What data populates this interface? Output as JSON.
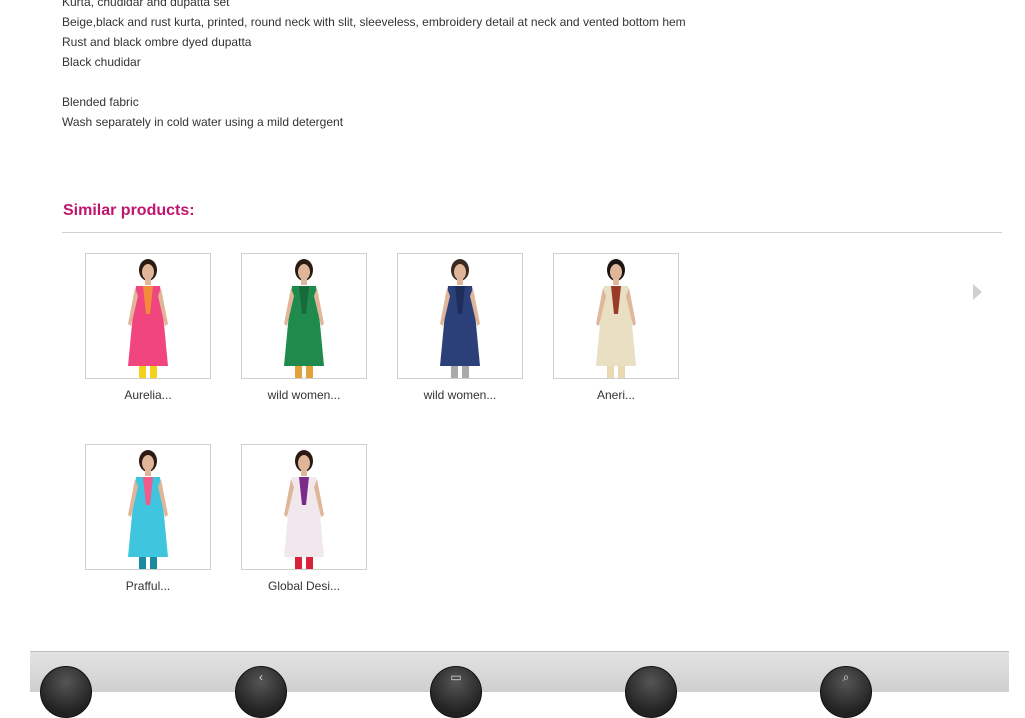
{
  "description": {
    "lines": [
      "Kurta, chudidar and dupatta set",
      "Beige,black and rust kurta, printed, round neck with slit, sleeveless, embroidery detail at neck and vented bottom hem",
      "Rust and black ombre dyed dupatta",
      "Black chudidar"
    ],
    "care": [
      "Blended fabric",
      "Wash separately in cold water using a mild detergent"
    ]
  },
  "similar": {
    "title": "Similar products:",
    "products": [
      {
        "name": "Aurelia...",
        "dress": "#f0457e",
        "accent": "#f28c3c",
        "legs": "#f2d21b",
        "hair": "#2a1a12",
        "icon": "dress-pink-icon"
      },
      {
        "name": "wild women...",
        "dress": "#1f8a4c",
        "accent": "#176b3a",
        "legs": "#e2a23a",
        "hair": "#2a1a12",
        "icon": "dress-green-icon"
      },
      {
        "name": "wild women...",
        "dress": "#2b3f78",
        "accent": "#1f2d5a",
        "legs": "#a9a9a9",
        "hair": "#3a2a22",
        "icon": "dress-navy-icon"
      },
      {
        "name": "Aneri...",
        "dress": "#e9dfc3",
        "accent": "#9a3b2a",
        "legs": "#e8d9b0",
        "hair": "#1a1412",
        "icon": "dress-printed-icon"
      },
      {
        "name": "Prafful...",
        "dress": "#3fc6de",
        "accent": "#f05a8c",
        "legs": "#1a8aa0",
        "hair": "#2a1a12",
        "icon": "dress-turquoise-icon"
      },
      {
        "name": "Global Desi...",
        "dress": "#f1e8ee",
        "accent": "#7d2a8a",
        "legs": "#d9213a",
        "hair": "#2a1a12",
        "icon": "dress-embroidered-icon"
      }
    ]
  },
  "bottom_bar": {
    "buttons": [
      {
        "icon": "home-icon",
        "glyph": ""
      },
      {
        "icon": "back-icon",
        "glyph": "‹"
      },
      {
        "icon": "menu-icon",
        "glyph": "▭"
      },
      {
        "icon": "dot-icon",
        "glyph": ""
      },
      {
        "icon": "search-icon",
        "glyph": "⌕"
      }
    ]
  }
}
